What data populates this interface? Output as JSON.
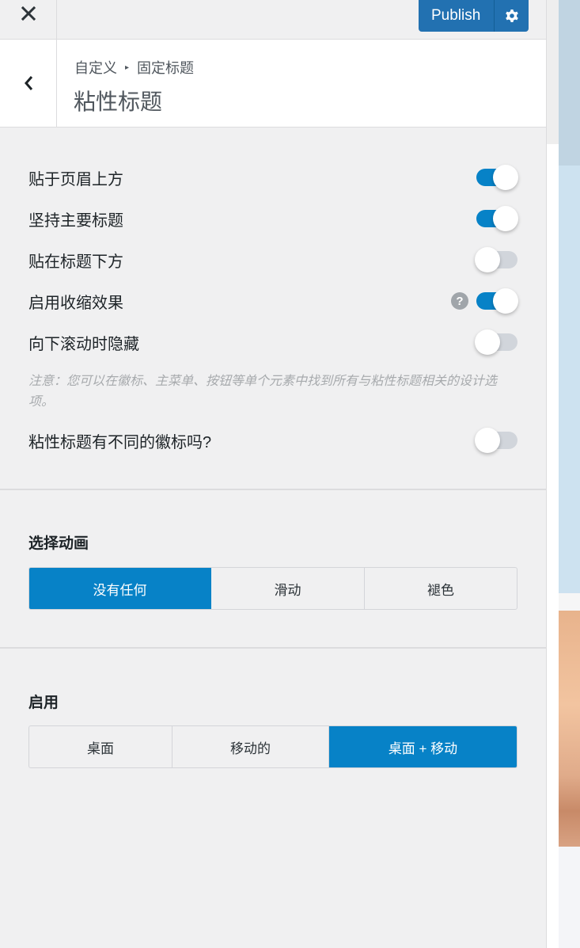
{
  "topbar": {
    "close_icon": "close-icon",
    "publish_label": "Publish",
    "settings_icon": "gear-icon"
  },
  "header": {
    "back_icon": "chevron-left-icon",
    "breadcrumb": [
      "自定义",
      "固定标题"
    ],
    "breadcrumb_separator": "▸",
    "title": "粘性标题"
  },
  "toggles": [
    {
      "label": "贴于页眉上方",
      "on": true,
      "help": false
    },
    {
      "label": "坚持主要标题",
      "on": true,
      "help": false
    },
    {
      "label": "贴在标题下方",
      "on": false,
      "help": false
    },
    {
      "label": "启用收缩效果",
      "on": true,
      "help": true
    },
    {
      "label": "向下滚动时隐藏",
      "on": false,
      "help": false
    }
  ],
  "note": "注意：您可以在徽标、主菜单、按钮等单个元素中找到所有与粘性标题相关的设计选项。",
  "logo_toggle": {
    "label": "粘性标题有不同的徽标吗?",
    "on": false
  },
  "help_icon_glyph": "?",
  "animation": {
    "label": "选择动画",
    "options": [
      "没有任何",
      "滑动",
      "褪色"
    ],
    "selected": 0
  },
  "enable": {
    "label": "启用",
    "options": [
      "桌面",
      "移动的",
      "桌面 + 移动"
    ],
    "selected": 2
  },
  "colors": {
    "publish": "#2271b1",
    "toggle_on": "#0782c7",
    "toggle_off": "#d1d5db",
    "segment_active": "#0782c7"
  }
}
